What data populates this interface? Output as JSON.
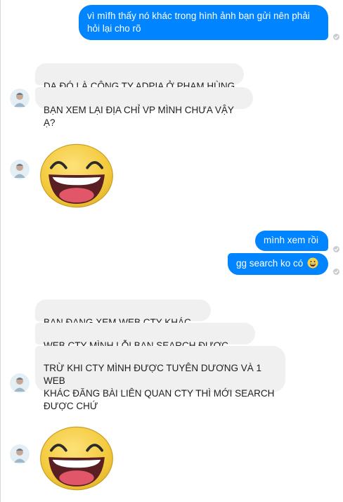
{
  "conversation": {
    "messages": [
      {
        "from": "me",
        "text": "vì mìfh thấy nó khác trong hình ảnh bạn gửi nên phải hỏi lại cho rõ"
      },
      {
        "from": "them",
        "text": "DẠ  ĐÓ LÀ CÔNG TY ADPIA Ở PHẠM HÙNG"
      },
      {
        "from": "them",
        "text": "BẠN XEM LẠI ĐỊA CHỈ VP MÌNH CHƯA VẬY Ạ?"
      },
      {
        "from": "them",
        "sticker": "laughing-face-sticker"
      },
      {
        "from": "me",
        "text": "mình xem rồi"
      },
      {
        "from": "me",
        "text": "gg search ko có",
        "emoji": "grinning-face-icon"
      },
      {
        "from": "them",
        "text": "BẠN ĐANG XEM WEB CTY KHÁC MÀ"
      },
      {
        "from": "them",
        "text": "WEB CTY MÌNH LỖI BẠN SEARCH ĐƯỢC Ạ????"
      },
      {
        "from": "them",
        "text": "TRỪ KHI CTY MÌNH ĐƯỢC TUYÊN DƯƠNG VÀ 1 WEB\nKHÁC ĐĂNG BÀI LIÊN QUAN CTY THÌ MỚI  SEARCH\nĐƯỢC CHỨ"
      },
      {
        "from": "them",
        "sticker": "laughing-face-sticker"
      }
    ]
  },
  "colors": {
    "outgoing_bubble": "#0084ff",
    "incoming_bubble": "#f1f0f0",
    "seen_indicator": "#c9ccd1",
    "sticker_face": "#f5d048"
  }
}
